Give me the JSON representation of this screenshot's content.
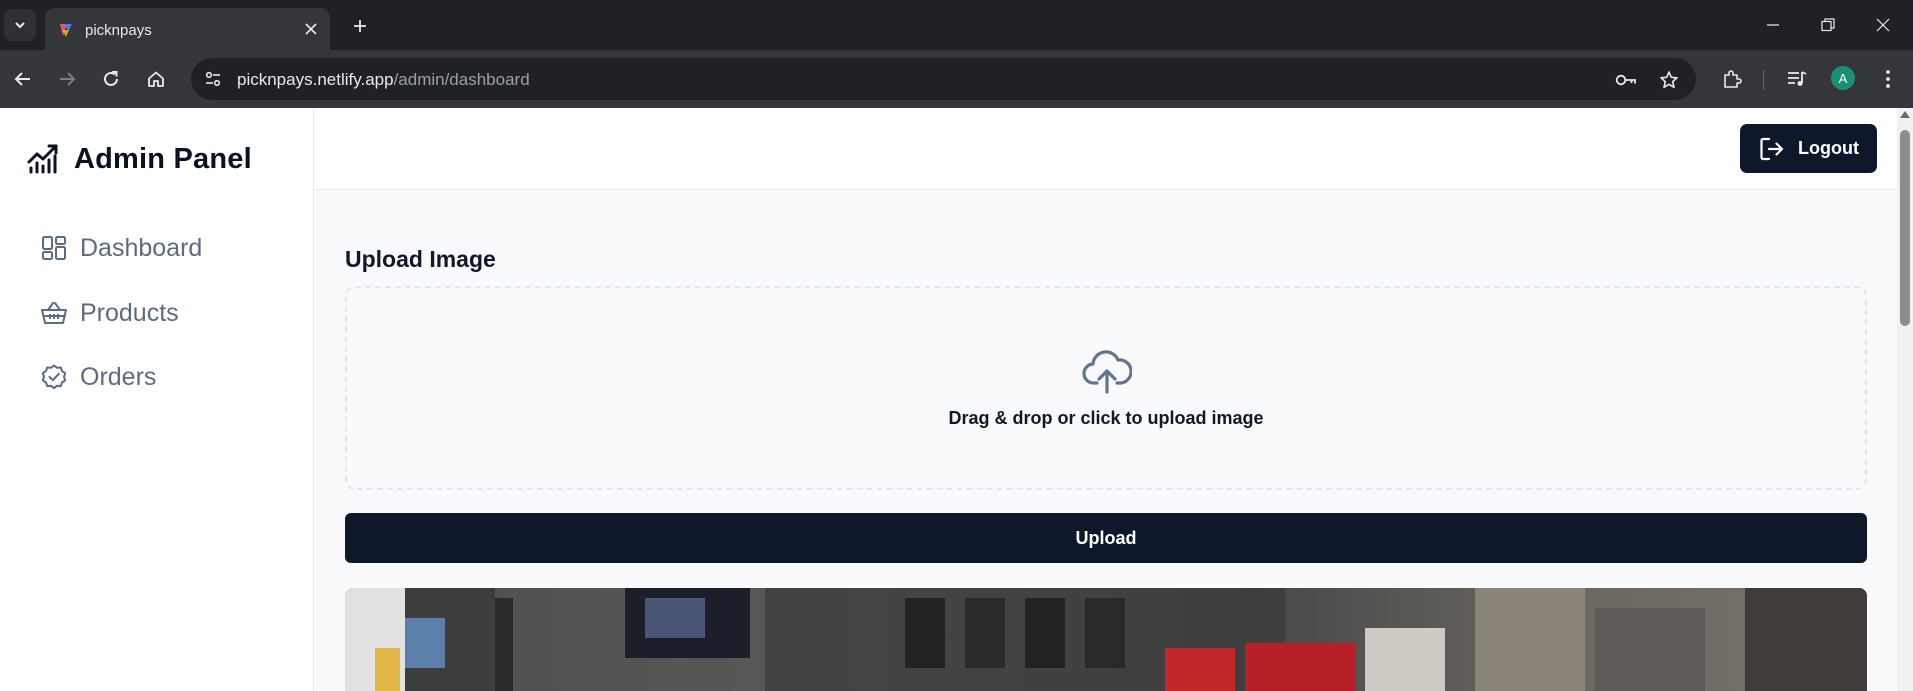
{
  "browser": {
    "tab_title": "picknpays",
    "url_host": "picknpays.netlify.app",
    "url_path": "/admin/dashboard",
    "profile_initial": "A",
    "icons": [
      "tab-search-icon",
      "close-icon",
      "plus-icon",
      "back-icon",
      "forward-icon",
      "reload-icon",
      "home-icon",
      "site-info-icon",
      "key-icon",
      "star-icon",
      "extensions-icon",
      "media-icon",
      "menu-icon",
      "minimize-icon",
      "restore-icon",
      "window-close-icon"
    ]
  },
  "sidebar": {
    "brand_title": "Admin Panel",
    "brand_icon": "chart-line-icon",
    "items": [
      {
        "label": "Dashboard",
        "icon": "grid-icon"
      },
      {
        "label": "Products",
        "icon": "basket-icon"
      },
      {
        "label": "Orders",
        "icon": "check-badge-icon"
      }
    ]
  },
  "topbar": {
    "logout_label": "Logout",
    "logout_icon": "logout-icon"
  },
  "main": {
    "section_title": "Upload Image",
    "dropzone_text": "Drag & drop or click to upload image",
    "dropzone_icon": "cloud-upload-icon",
    "upload_label": "Upload"
  },
  "colors": {
    "primary": "#0f172a",
    "muted_text": "#5b6b82",
    "background": "#f8fafc",
    "chrome_dark": "#202124",
    "chrome_toolbar": "#35363a",
    "profile": "#1a8f75"
  }
}
